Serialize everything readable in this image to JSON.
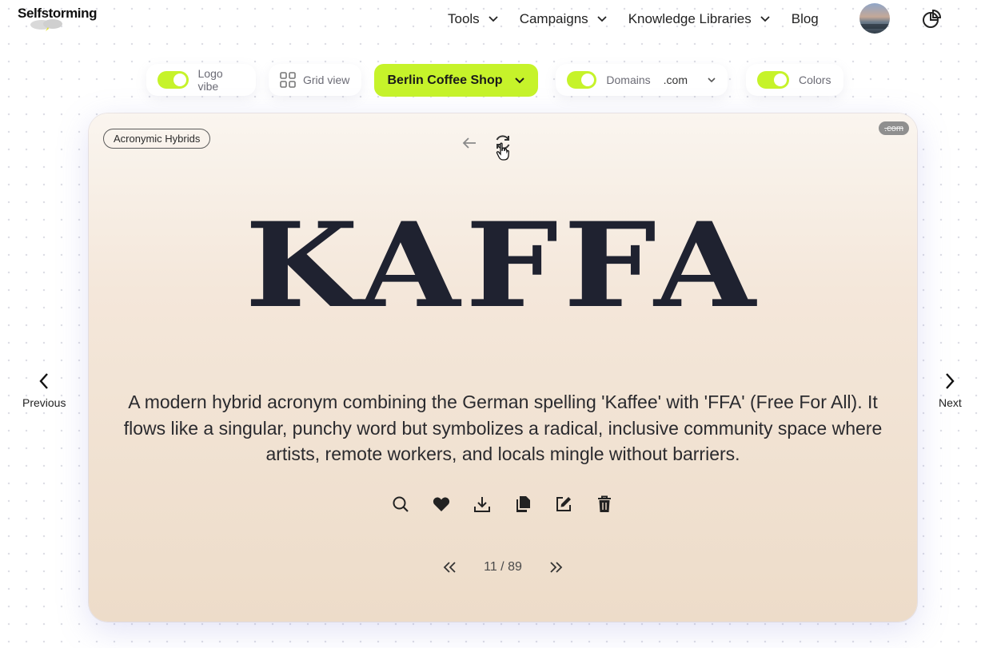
{
  "app": {
    "logo": "Selfstorming"
  },
  "nav": {
    "items": [
      {
        "label": "Tools",
        "has_dropdown": true
      },
      {
        "label": "Campaigns",
        "has_dropdown": true
      },
      {
        "label": "Knowledge Libraries",
        "has_dropdown": true
      },
      {
        "label": "Blog",
        "has_dropdown": false
      }
    ]
  },
  "toolbar": {
    "logo_vibe": {
      "label": "Logo vibe",
      "enabled": true
    },
    "grid_view": {
      "label": "Grid view"
    },
    "project": {
      "label": "Berlin Coffee Shop"
    },
    "domains": {
      "label": "Domains",
      "enabled": true,
      "tld": ".com"
    },
    "colors": {
      "label": "Colors",
      "enabled": true
    }
  },
  "card": {
    "category": "Acronymic Hybrids",
    "domain_badge": ".com",
    "name": "KAFFA",
    "description": "A modern hybrid acronym combining the German spelling 'Kaffee' with 'FFA' (Free For All). It flows like a singular, punchy word but symbolizes a radical, inclusive community space where artists, remote workers, and locals mingle without barriers.",
    "actions": [
      "search-icon",
      "heart-icon",
      "download-icon",
      "copy-icon",
      "edit-icon",
      "trash-icon"
    ],
    "pager": {
      "current": 11,
      "total": 89,
      "text": "11 / 89"
    }
  },
  "side_nav": {
    "previous": "Previous",
    "next": "Next"
  },
  "colors": {
    "accent": "#c6f32a",
    "text": "#1f2230",
    "card_bg": "#f4e7da"
  }
}
